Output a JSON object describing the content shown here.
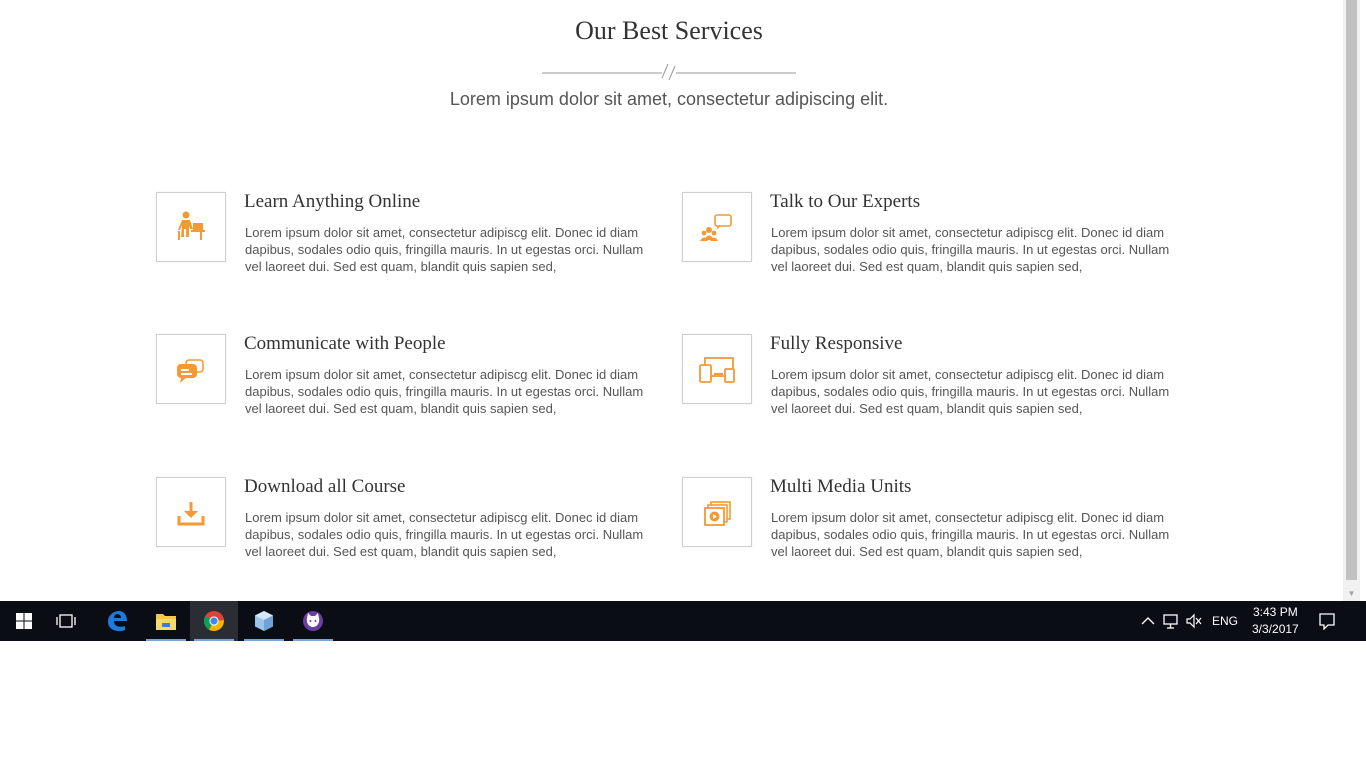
{
  "page": {
    "title": "Our Best Services",
    "subtitle": "Lorem ipsum dolor sit amet, consectetur adipiscing elit.",
    "accent_color": "#f39a34"
  },
  "services": [
    {
      "title": "Learn Anything Online",
      "text": "Lorem ipsum dolor sit amet, consectetur adipiscg elit. Donec id diam dapibus, sodales odio quis, fringilla mauris. In ut egestas orci. Nullam vel laoreet dui. Sed est quam, blandit quis sapien sed,",
      "icon": "student-desk-icon"
    },
    {
      "title": "Talk to Our Experts",
      "text": "Lorem ipsum dolor sit amet, consectetur adipiscg elit. Donec id diam dapibus, sodales odio quis, fringilla mauris. In ut egestas orci. Nullam vel laoreet dui. Sed est quam, blandit quis sapien sed,",
      "icon": "group-chat-icon"
    },
    {
      "title": "Communicate with People",
      "text": "Lorem ipsum dolor sit amet, consectetur adipiscg elit. Donec id diam dapibus, sodales odio quis, fringilla mauris. In ut egestas orci. Nullam vel laoreet dui. Sed est quam, blandit quis sapien sed,",
      "icon": "chat-bubbles-icon"
    },
    {
      "title": "Fully Responsive",
      "text": "Lorem ipsum dolor sit amet, consectetur adipiscg elit. Donec id diam dapibus, sodales odio quis, fringilla mauris. In ut egestas orci. Nullam vel laoreet dui. Sed est quam, blandit quis sapien sed,",
      "icon": "responsive-devices-icon"
    },
    {
      "title": "Download all Course",
      "text": "Lorem ipsum dolor sit amet, consectetur adipiscg elit. Donec id diam dapibus, sodales odio quis, fringilla mauris. In ut egestas orci. Nullam vel laoreet dui. Sed est quam, blandit quis sapien sed,",
      "icon": "download-icon"
    },
    {
      "title": "Multi Media Units",
      "text": "Lorem ipsum dolor sit amet, consectetur adipiscg elit. Donec id diam dapibus, sodales odio quis, fringilla mauris. In ut egestas orci. Nullam vel laoreet dui. Sed est quam, blandit quis sapien sed,",
      "icon": "media-stack-icon"
    }
  ],
  "taskbar": {
    "apps": [
      "windows-start-icon",
      "task-view-icon",
      "edge-icon",
      "file-explorer-icon",
      "chrome-icon",
      "box-app-icon",
      "cat-app-icon"
    ],
    "active_app": "chrome-icon",
    "language": "ENG",
    "time": "3:43 PM",
    "date": "3/3/2017",
    "background_color": "#0a0d14"
  }
}
